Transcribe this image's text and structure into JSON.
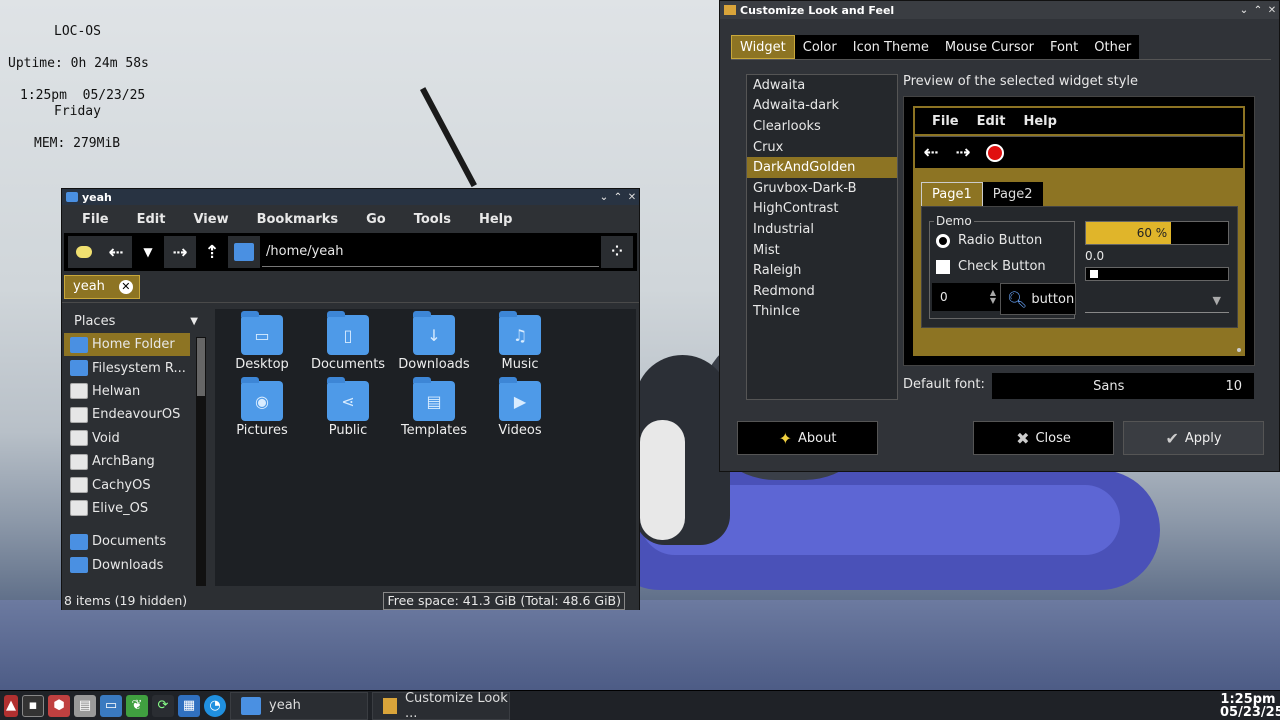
{
  "conky": {
    "os": "LOC-OS",
    "uptime": "Uptime: 0h 24m 58s",
    "time_date": "1:25pm  05/23/25",
    "day": "Friday",
    "mem": "MEM: 279MiB"
  },
  "file_manager": {
    "title": "yeah",
    "menu": [
      "File",
      "Edit",
      "View",
      "Bookmarks",
      "Go",
      "Tools",
      "Help"
    ],
    "path": "/home/yeah",
    "tab_label": "yeah",
    "places_header": "Places",
    "places": [
      {
        "label": "Home Folder",
        "icon": "home-folder-icon",
        "selected": true
      },
      {
        "label": "Filesystem R...",
        "icon": "folder-icon"
      },
      {
        "label": "Helwan",
        "icon": "drive-icon"
      },
      {
        "label": "EndeavourOS",
        "icon": "drive-icon"
      },
      {
        "label": "Void",
        "icon": "drive-icon"
      },
      {
        "label": "ArchBang",
        "icon": "drive-icon"
      },
      {
        "label": "CachyOS",
        "icon": "drive-icon"
      },
      {
        "label": "Elive_OS",
        "icon": "drive-icon"
      },
      {
        "label": "Documents",
        "icon": "folder-icon"
      },
      {
        "label": "Downloads",
        "icon": "folder-icon"
      }
    ],
    "items": [
      {
        "label": "Desktop",
        "glyph": "▭"
      },
      {
        "label": "Documents",
        "glyph": "▯"
      },
      {
        "label": "Downloads",
        "glyph": "↓"
      },
      {
        "label": "Music",
        "glyph": "♫"
      },
      {
        "label": "Pictures",
        "glyph": "◉"
      },
      {
        "label": "Public",
        "glyph": "⋖"
      },
      {
        "label": "Templates",
        "glyph": "▤"
      },
      {
        "label": "Videos",
        "glyph": "▶"
      }
    ],
    "status_items": "8 items (19 hidden)",
    "status_free": "Free space: 41.3 GiB (Total: 48.6 GiB)"
  },
  "customize": {
    "title": "Customize Look and Feel",
    "tabs": [
      "Widget",
      "Color",
      "Icon Theme",
      "Mouse Cursor",
      "Font",
      "Other"
    ],
    "themes": [
      "Adwaita",
      "Adwaita-dark",
      "Clearlooks",
      "Crux",
      "DarkAndGolden",
      "Gruvbox-Dark-B",
      "HighContrast",
      "Industrial",
      "Mist",
      "Raleigh",
      "Redmond",
      "ThinIce"
    ],
    "selected_theme": "DarkAndGolden",
    "preview_heading": "Preview of the selected widget style",
    "preview_menu": [
      "File",
      "Edit",
      "Help"
    ],
    "preview_tabs": [
      "Page1",
      "Page2"
    ],
    "demo_label": "Demo",
    "radio_label": "Radio Button",
    "check_label": "Check Button",
    "spin_value": "0",
    "button_label": "button",
    "progress_text": "60 %",
    "progress_value": 60,
    "slider_value": "0.0",
    "default_font_label": "Default font:",
    "font_name": "Sans",
    "font_size": "10",
    "about": "About",
    "close": "Close",
    "apply": "Apply"
  },
  "taskbar": {
    "tasks": [
      "yeah",
      "Customize Look ..."
    ],
    "clock_time": "1:25pm",
    "clock_date": "05/23/25"
  },
  "colors": {
    "accent": "#8d7423",
    "progress": "#e0b52a",
    "folder": "#4e9ae8"
  }
}
